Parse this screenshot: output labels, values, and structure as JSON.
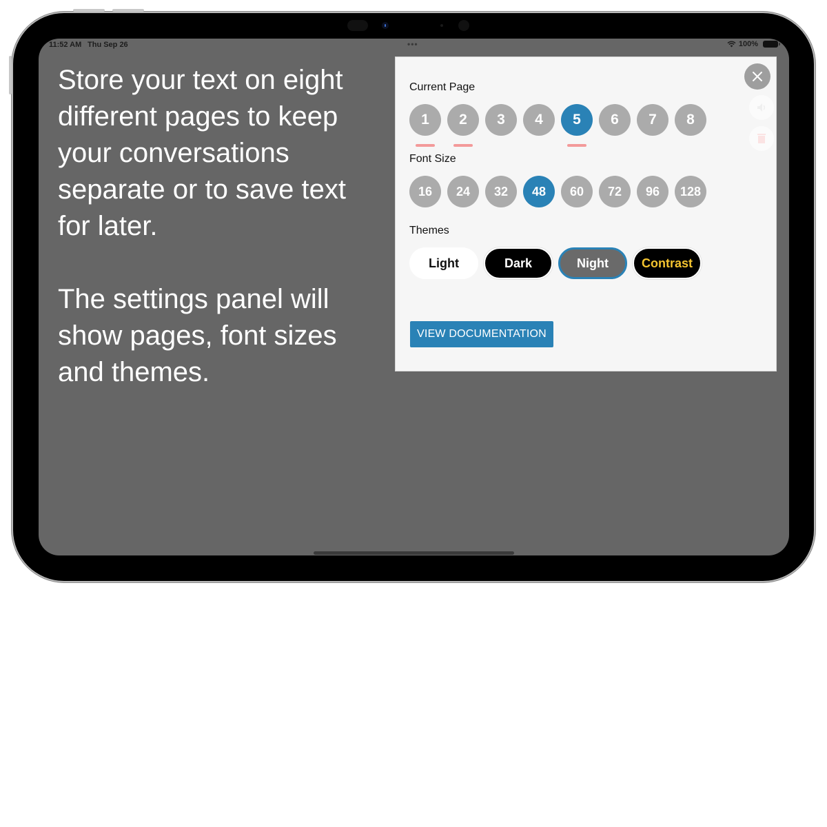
{
  "status_bar": {
    "time": "11:52 AM",
    "date": "Thu Sep 26",
    "multitask_dots": "•••",
    "battery_percent": "100%"
  },
  "intro": {
    "paragraphs": [
      "Store your text on eight different pages to keep your conversations separate or to save text for later.",
      "The settings panel will show pages, font sizes and themes."
    ]
  },
  "panel": {
    "current_page": {
      "label": "Current Page",
      "pages": [
        {
          "label": "1",
          "has_content": true,
          "selected": false
        },
        {
          "label": "2",
          "has_content": true,
          "selected": false
        },
        {
          "label": "3",
          "has_content": false,
          "selected": false
        },
        {
          "label": "4",
          "has_content": false,
          "selected": false
        },
        {
          "label": "5",
          "has_content": true,
          "selected": true
        },
        {
          "label": "6",
          "has_content": false,
          "selected": false
        },
        {
          "label": "7",
          "has_content": false,
          "selected": false
        },
        {
          "label": "8",
          "has_content": false,
          "selected": false
        }
      ]
    },
    "font_size": {
      "label": "Font Size",
      "sizes": [
        {
          "label": "16",
          "selected": false
        },
        {
          "label": "24",
          "selected": false
        },
        {
          "label": "32",
          "selected": false
        },
        {
          "label": "48",
          "selected": true
        },
        {
          "label": "60",
          "selected": false
        },
        {
          "label": "72",
          "selected": false
        },
        {
          "label": "96",
          "selected": false
        },
        {
          "label": "128",
          "selected": false
        }
      ]
    },
    "themes": {
      "label": "Themes",
      "options": [
        {
          "label": "Light",
          "selected": false
        },
        {
          "label": "Dark",
          "selected": false
        },
        {
          "label": "Night",
          "selected": true
        },
        {
          "label": "Contrast",
          "selected": false
        }
      ]
    },
    "doc_button_label": "VIEW DOCUMENTATION",
    "icons": {
      "close": "close-icon",
      "speaker": "speaker-icon",
      "trash": "trash-icon"
    }
  },
  "colors": {
    "accent": "#2a82b6",
    "inactive_circle": "#ababab",
    "page_marker": "#f39a9a",
    "screen_bg": "#666666",
    "panel_bg": "#f6f6f6",
    "contrast_text": "#f4c430"
  }
}
